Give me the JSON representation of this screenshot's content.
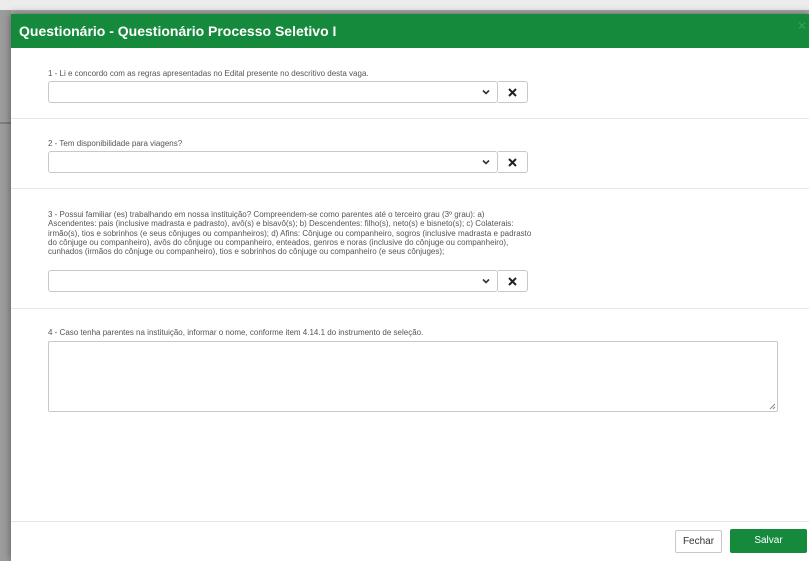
{
  "modal": {
    "title": "Questionário - Questionário Processo Seletivo I",
    "close_glyph": "✕"
  },
  "questions": [
    {
      "label": "1 - Li e concordo com as regras apresentadas no Edital presente no descritivo desta vaga.",
      "selected": ""
    },
    {
      "label": "2 - Tem disponibilidade para viagens?",
      "selected": ""
    },
    {
      "label": "3 - Possui familiar (es) trabalhando em nossa instituição? Compreendem-se como parentes até o terceiro grau (3º grau): a) Ascendentes: pais (inclusive madrasta e padrasto), avô(s) e bisavô(s); b) Descendentes: filho(s), neto(s) e bisneto(s); c) Colaterais: irmão(s), tios e sobrinhos (e seus cônjuges ou companheiros); d) Afins: Cônjuge ou companheiro, sogros (inclusive madrasta e padrasto do cônjuge ou companheiro), avôs do cônjuge ou companheiro, enteados, genros e noras (inclusive do cônjuge ou companheiro), cunhados (irmãos do cônjuge ou companheiro), tios e sobrinhos do cônjuge ou companheiro (e seus cônjuges);",
      "selected": ""
    },
    {
      "label": "4 - Caso tenha parentes na instituição, informar o nome, conforme item 4.14.1 do instrumento de seleção.",
      "value": ""
    }
  ],
  "footer": {
    "close_label": "Fechar",
    "save_label": "Salvar"
  },
  "colors": {
    "header": "#168a3c",
    "save_button": "#168a3c"
  },
  "icons": {
    "select": "chevron-down-icon",
    "clear": "x-icon",
    "resize": "resize-grip-icon"
  }
}
